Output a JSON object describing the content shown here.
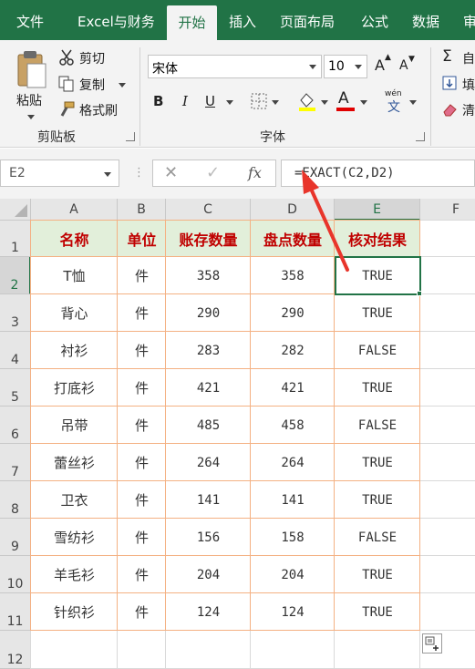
{
  "ribbon": {
    "tabs": [
      "文件",
      "Excel与财务",
      "开始",
      "插入",
      "页面布局",
      "公式",
      "数据",
      "审"
    ],
    "active_tab": "开始",
    "clipboard": {
      "paste": "粘贴",
      "cut": "剪切",
      "copy": "复制",
      "format_painter": "格式刷",
      "group_label": "剪贴板"
    },
    "font": {
      "font_name": "宋体",
      "font_size": "10",
      "bold": "B",
      "italic": "I",
      "underline": "U",
      "font_color_letter": "A",
      "phonetic_top": "wén",
      "phonetic_char": "文",
      "group_label": "字体"
    },
    "editing": {
      "sum_label": "自",
      "fill_label": "填",
      "clear_label": "清"
    }
  },
  "formula_bar": {
    "name_box": "E2",
    "fx": "fx",
    "formula": "=EXACT(C2,D2)"
  },
  "grid": {
    "columns": [
      "A",
      "B",
      "C",
      "D",
      "E",
      "F"
    ],
    "rows": [
      "1",
      "2",
      "3",
      "4",
      "5",
      "6",
      "7",
      "8",
      "9",
      "10",
      "11",
      "12"
    ],
    "selected_column": "E",
    "selected_row": "2",
    "header": [
      "名称",
      "单位",
      "账存数量",
      "盘点数量",
      "核对结果"
    ],
    "data": [
      [
        "T恤",
        "件",
        "358",
        "358",
        "TRUE"
      ],
      [
        "背心",
        "件",
        "290",
        "290",
        "TRUE"
      ],
      [
        "衬衫",
        "件",
        "283",
        "282",
        "FALSE"
      ],
      [
        "打底衫",
        "件",
        "421",
        "421",
        "TRUE"
      ],
      [
        "吊带",
        "件",
        "485",
        "458",
        "FALSE"
      ],
      [
        "蕾丝衫",
        "件",
        "264",
        "264",
        "TRUE"
      ],
      [
        "卫衣",
        "件",
        "141",
        "141",
        "TRUE"
      ],
      [
        "雪纺衫",
        "件",
        "156",
        "158",
        "FALSE"
      ],
      [
        "羊毛衫",
        "件",
        "204",
        "204",
        "TRUE"
      ],
      [
        "针织衫",
        "件",
        "124",
        "124",
        "TRUE"
      ]
    ]
  },
  "colors": {
    "ribbon_green": "#217346",
    "header_fill": "#e2efda",
    "header_text": "#c00000",
    "border_orange": "#f4b183",
    "arrow_red": "#e8352b"
  }
}
